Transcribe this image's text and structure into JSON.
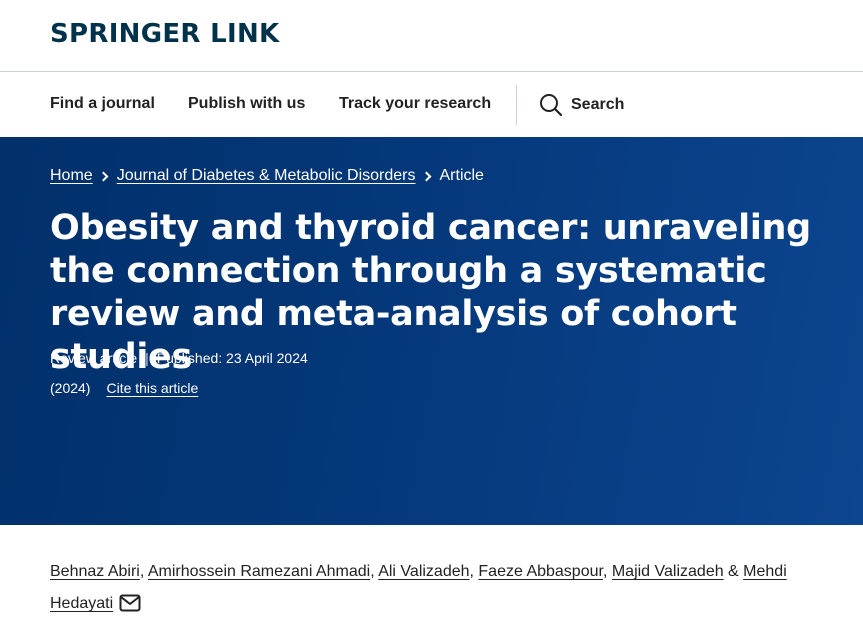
{
  "header": {
    "logo_text": "Springer Link"
  },
  "nav": {
    "items": [
      {
        "label": "Find a journal"
      },
      {
        "label": "Publish with us"
      },
      {
        "label": "Track your research"
      }
    ],
    "search_label": "Search",
    "search_icon": "search-icon"
  },
  "hero": {
    "breadcrumb": [
      {
        "label": "Home"
      },
      {
        "label": "Journal of Diabetes & Metabolic Disorders"
      },
      {
        "label": "Article"
      }
    ],
    "title": "Obesity and thyroid cancer: unraveling the connection through a systematic review and meta-analysis of cohort studies",
    "article_type": "Review article",
    "meta_separator": "|",
    "published": "Published: 23 April 2024",
    "year": "(2024)",
    "cite_label": "Cite this article",
    "background_color": "#01306a"
  },
  "authors": {
    "list": [
      {
        "name": "Behnaz Abiri",
        "sep": ", "
      },
      {
        "name": "Amirhossein Ramezani Ahmadi",
        "sep": ", "
      },
      {
        "name": "Ali Valizadeh",
        "sep": ", "
      },
      {
        "name": "Faeze Abbaspour",
        "sep": ", "
      },
      {
        "name": "Majid Valizadeh",
        "sep": " & "
      },
      {
        "name": "Mehdi Hedayati",
        "sep": ""
      }
    ],
    "corresponding_icon": "email-icon"
  },
  "colors": {
    "brand": "#01324b",
    "hero_blue": "#01306a",
    "text": "#222222"
  }
}
